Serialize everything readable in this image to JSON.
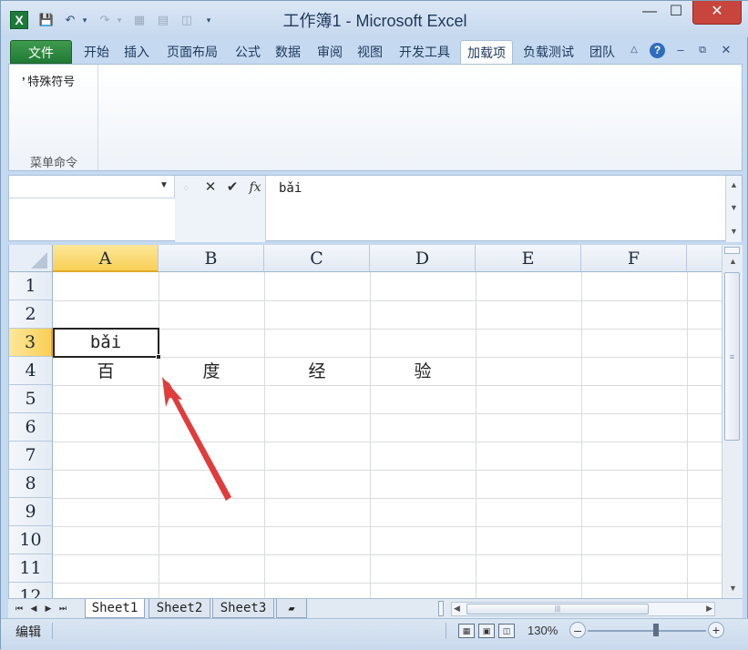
{
  "window": {
    "title": "工作簿1 - Microsoft Excel",
    "app_icon_letter": "X"
  },
  "quick_access": {
    "save_icon": "save-icon",
    "undo_icon": "undo-icon",
    "redo_icon": "redo-icon"
  },
  "ribbon": {
    "tabs": [
      "文件",
      "开始",
      "插入",
      "页面布局",
      "公式",
      "数据",
      "审阅",
      "视图",
      "开发工具",
      "加载项",
      "负载测试",
      "团队"
    ],
    "active_tab": "加载项",
    "group_button": "特殊符号",
    "group_label": "菜单命令"
  },
  "formula_bar": {
    "name_box": "",
    "fx_label": "fx",
    "content": "bǎi"
  },
  "grid": {
    "columns": [
      "A",
      "B",
      "C",
      "D",
      "E",
      "F"
    ],
    "rows": [
      "1",
      "2",
      "3",
      "4",
      "5",
      "6",
      "7",
      "8",
      "9",
      "10",
      "11",
      "12"
    ],
    "selected_column": "A",
    "selected_row": "3",
    "cells": {
      "A3": "bǎi",
      "A4": "百",
      "B4": "度",
      "C4": "经",
      "D4": "验"
    }
  },
  "sheets": [
    "Sheet1",
    "Sheet2",
    "Sheet3"
  ],
  "active_sheet": "Sheet1",
  "status": {
    "mode": "编辑",
    "zoom": "130%"
  },
  "colors": {
    "accent_green": "#217a34",
    "selection_gold": "#f9cf55",
    "arrow_red": "#e03c3c"
  }
}
